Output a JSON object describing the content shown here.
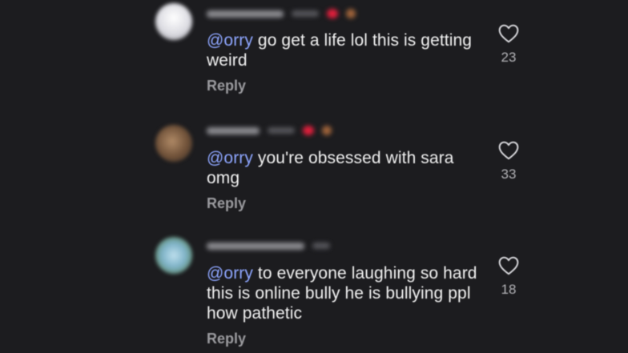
{
  "comments": [
    {
      "mention": "@orry",
      "text": " go get a life lol this is getting weird",
      "reply_label": "Reply",
      "like_count": "23",
      "avatar_color": "#e9e9ee",
      "avatar_icon": "profile-photo"
    },
    {
      "mention": "@orry",
      "text": " you're obsessed with sara omg",
      "reply_label": "Reply",
      "like_count": "33",
      "avatar_color": "#8a6a4e",
      "avatar_icon": "profile-photo"
    },
    {
      "mention": "@orry",
      "text": " to everyone laughing so hard this is online bully he is bullying ppl how pathetic",
      "reply_label": "Reply",
      "like_count": "18",
      "avatar_color": "#7fb3c8",
      "avatar_icon": "profile-photo"
    }
  ],
  "colors": {
    "background": "#1c1c1f",
    "mention": "#8ea6ff",
    "heart": "#e21f3c"
  },
  "icons": {
    "like": "heart-outline-icon"
  }
}
